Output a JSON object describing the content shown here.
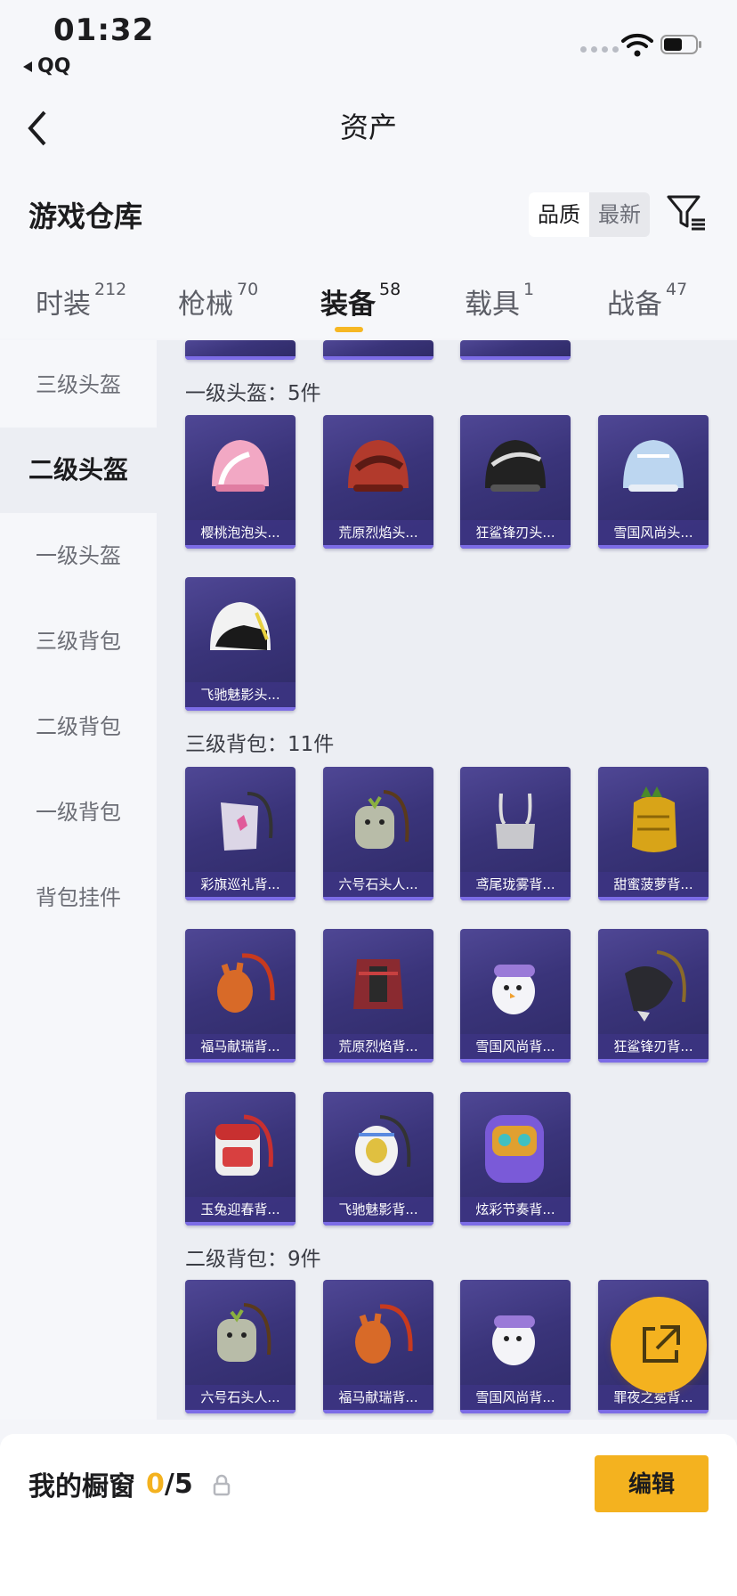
{
  "status_bar": {
    "time": "01:32",
    "back_app": "QQ"
  },
  "nav": {
    "title": "资产"
  },
  "header": {
    "title": "游戏仓库",
    "sort_options": [
      "品质",
      "最新"
    ]
  },
  "tabs": [
    {
      "label": "时装",
      "count": "212"
    },
    {
      "label": "枪械",
      "count": "70"
    },
    {
      "label": "装备",
      "count": "58"
    },
    {
      "label": "载具",
      "count": "1"
    },
    {
      "label": "战备",
      "count": "47"
    }
  ],
  "sidebar": {
    "items": [
      "三级头盔",
      "二级头盔",
      "一级头盔",
      "三级背包",
      "二级背包",
      "一级背包",
      "背包挂件"
    ]
  },
  "sections": {
    "s1": {
      "title": "一级头盔：5件",
      "items": [
        "樱桃泡泡头...",
        "荒原烈焰头...",
        "狂鲨锋刃头...",
        "雪国风尚头...",
        "飞驰魅影头..."
      ]
    },
    "s2": {
      "title": "三级背包：11件",
      "items": [
        "彩旗巡礼背...",
        "六号石头人...",
        "鸢尾珑雾背...",
        "甜蜜菠萝背...",
        "福马献瑞背...",
        "荒原烈焰背...",
        "雪国风尚背...",
        "狂鲨锋刃背...",
        "玉兔迎春背...",
        "飞驰魅影背...",
        "炫彩节奏背..."
      ]
    },
    "s3": {
      "title": "二级背包：9件",
      "items": [
        "六号石头人...",
        "福马献瑞背...",
        "雪国风尚背...",
        "罪夜之冕背..."
      ]
    }
  },
  "bottom": {
    "showcase_label": "我的橱窗",
    "used": "0",
    "total": "/5",
    "edit_label": "编辑"
  },
  "colors": {
    "accent": "#f4b21f",
    "card_bg": "#3a347a",
    "card_bar": "#7c6ce6"
  }
}
